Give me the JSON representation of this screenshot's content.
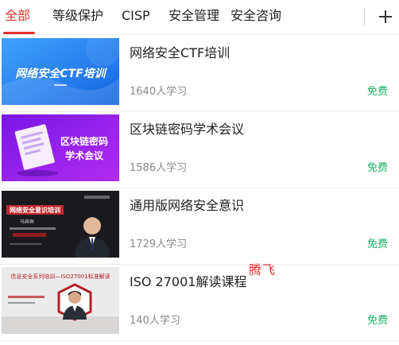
{
  "tabs": [
    {
      "label": "全部",
      "active": true
    },
    {
      "label": "等级保护",
      "active": false
    },
    {
      "label": "CISP",
      "active": false
    },
    {
      "label": "安全管理",
      "active": false
    },
    {
      "label": "安全咨询",
      "active": false
    }
  ],
  "add_icon": "plus-icon",
  "courses": [
    {
      "title": "网络安全CTF培训",
      "learners": "1640人学习",
      "price": "免费",
      "thumb_text": "网络安全CTF培训"
    },
    {
      "title": "区块链密码学术会议",
      "learners": "1586人学习",
      "price": "免费",
      "thumb_text": [
        "区块链密码",
        "学术会议"
      ]
    },
    {
      "title": "通用版网络安全意识",
      "learners": "1729人学习",
      "price": "免费",
      "thumb_text": {
        "banner": "网络安全意识培训",
        "speaker": "马奔奔"
      }
    },
    {
      "title": "ISO 27001解读课程",
      "learners": "140人学习",
      "price": "免费",
      "thumb_text": "信息安全系列培训—ISO27001标准解读"
    }
  ],
  "watermark": "腾飞",
  "colors": {
    "accent": "#e0312f",
    "free": "#19b163",
    "muted": "#8a8a8a"
  }
}
